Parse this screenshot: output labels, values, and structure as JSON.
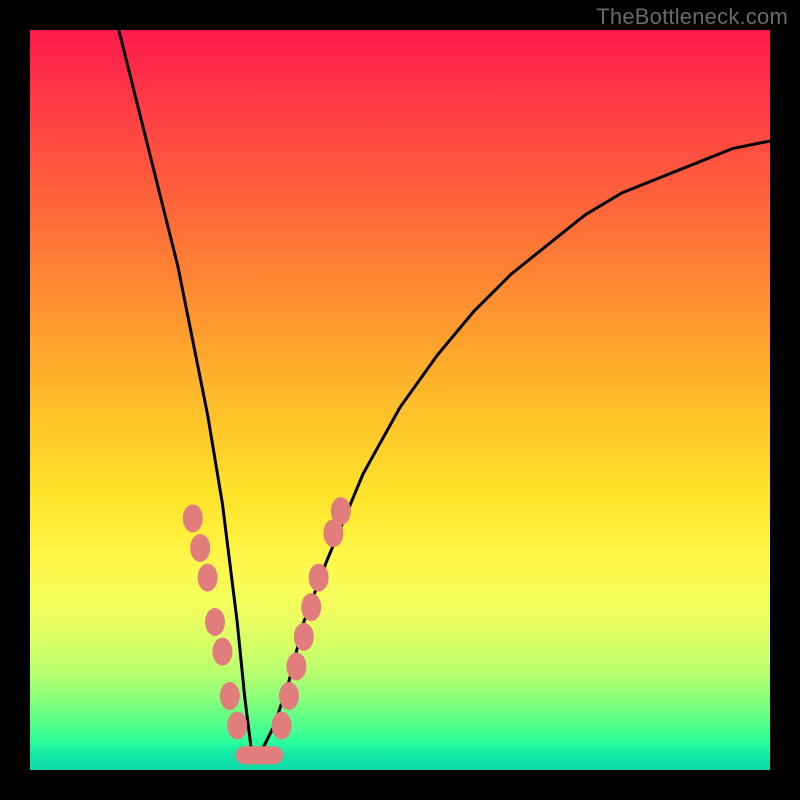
{
  "watermark": "TheBottleneck.com",
  "chart_data": {
    "type": "line",
    "title": "",
    "xlabel": "",
    "ylabel": "",
    "xlim": [
      0,
      100
    ],
    "ylim": [
      0,
      100
    ],
    "grid": false,
    "legend": false,
    "series": [
      {
        "name": "bottleneck-curve",
        "color": "#000000",
        "x": [
          12,
          14,
          16,
          18,
          20,
          22,
          24,
          26,
          27,
          28,
          29,
          30,
          31,
          33,
          35,
          37,
          40,
          45,
          50,
          55,
          60,
          65,
          70,
          75,
          80,
          85,
          90,
          95,
          100
        ],
        "y": [
          100,
          92,
          84,
          76,
          68,
          58,
          48,
          36,
          28,
          20,
          10,
          2,
          2,
          6,
          12,
          20,
          28,
          40,
          49,
          56,
          62,
          67,
          71,
          75,
          78,
          80,
          82,
          84,
          85
        ]
      }
    ],
    "highlight_clusters": [
      {
        "name": "left-branch-dots",
        "color": "#e17e7d",
        "points": [
          {
            "x": 22,
            "y": 34
          },
          {
            "x": 23,
            "y": 30
          },
          {
            "x": 24,
            "y": 26
          },
          {
            "x": 25,
            "y": 20
          },
          {
            "x": 26,
            "y": 16
          },
          {
            "x": 27,
            "y": 10
          },
          {
            "x": 28,
            "y": 6
          }
        ]
      },
      {
        "name": "valley-flat",
        "color": "#e17e7d",
        "points": [
          {
            "x": 29,
            "y": 2
          },
          {
            "x": 30,
            "y": 1
          },
          {
            "x": 31,
            "y": 1
          },
          {
            "x": 32,
            "y": 2
          },
          {
            "x": 33,
            "y": 2
          }
        ]
      },
      {
        "name": "right-branch-dots",
        "color": "#e17e7d",
        "points": [
          {
            "x": 34,
            "y": 6
          },
          {
            "x": 35,
            "y": 10
          },
          {
            "x": 36,
            "y": 14
          },
          {
            "x": 37,
            "y": 18
          },
          {
            "x": 38,
            "y": 22
          },
          {
            "x": 39,
            "y": 26
          },
          {
            "x": 41,
            "y": 32
          },
          {
            "x": 42,
            "y": 35
          }
        ]
      }
    ],
    "background_gradient": {
      "top": "#ff1a4d",
      "mid": "#ffe42a",
      "bottom": "#0fd8a8"
    }
  }
}
